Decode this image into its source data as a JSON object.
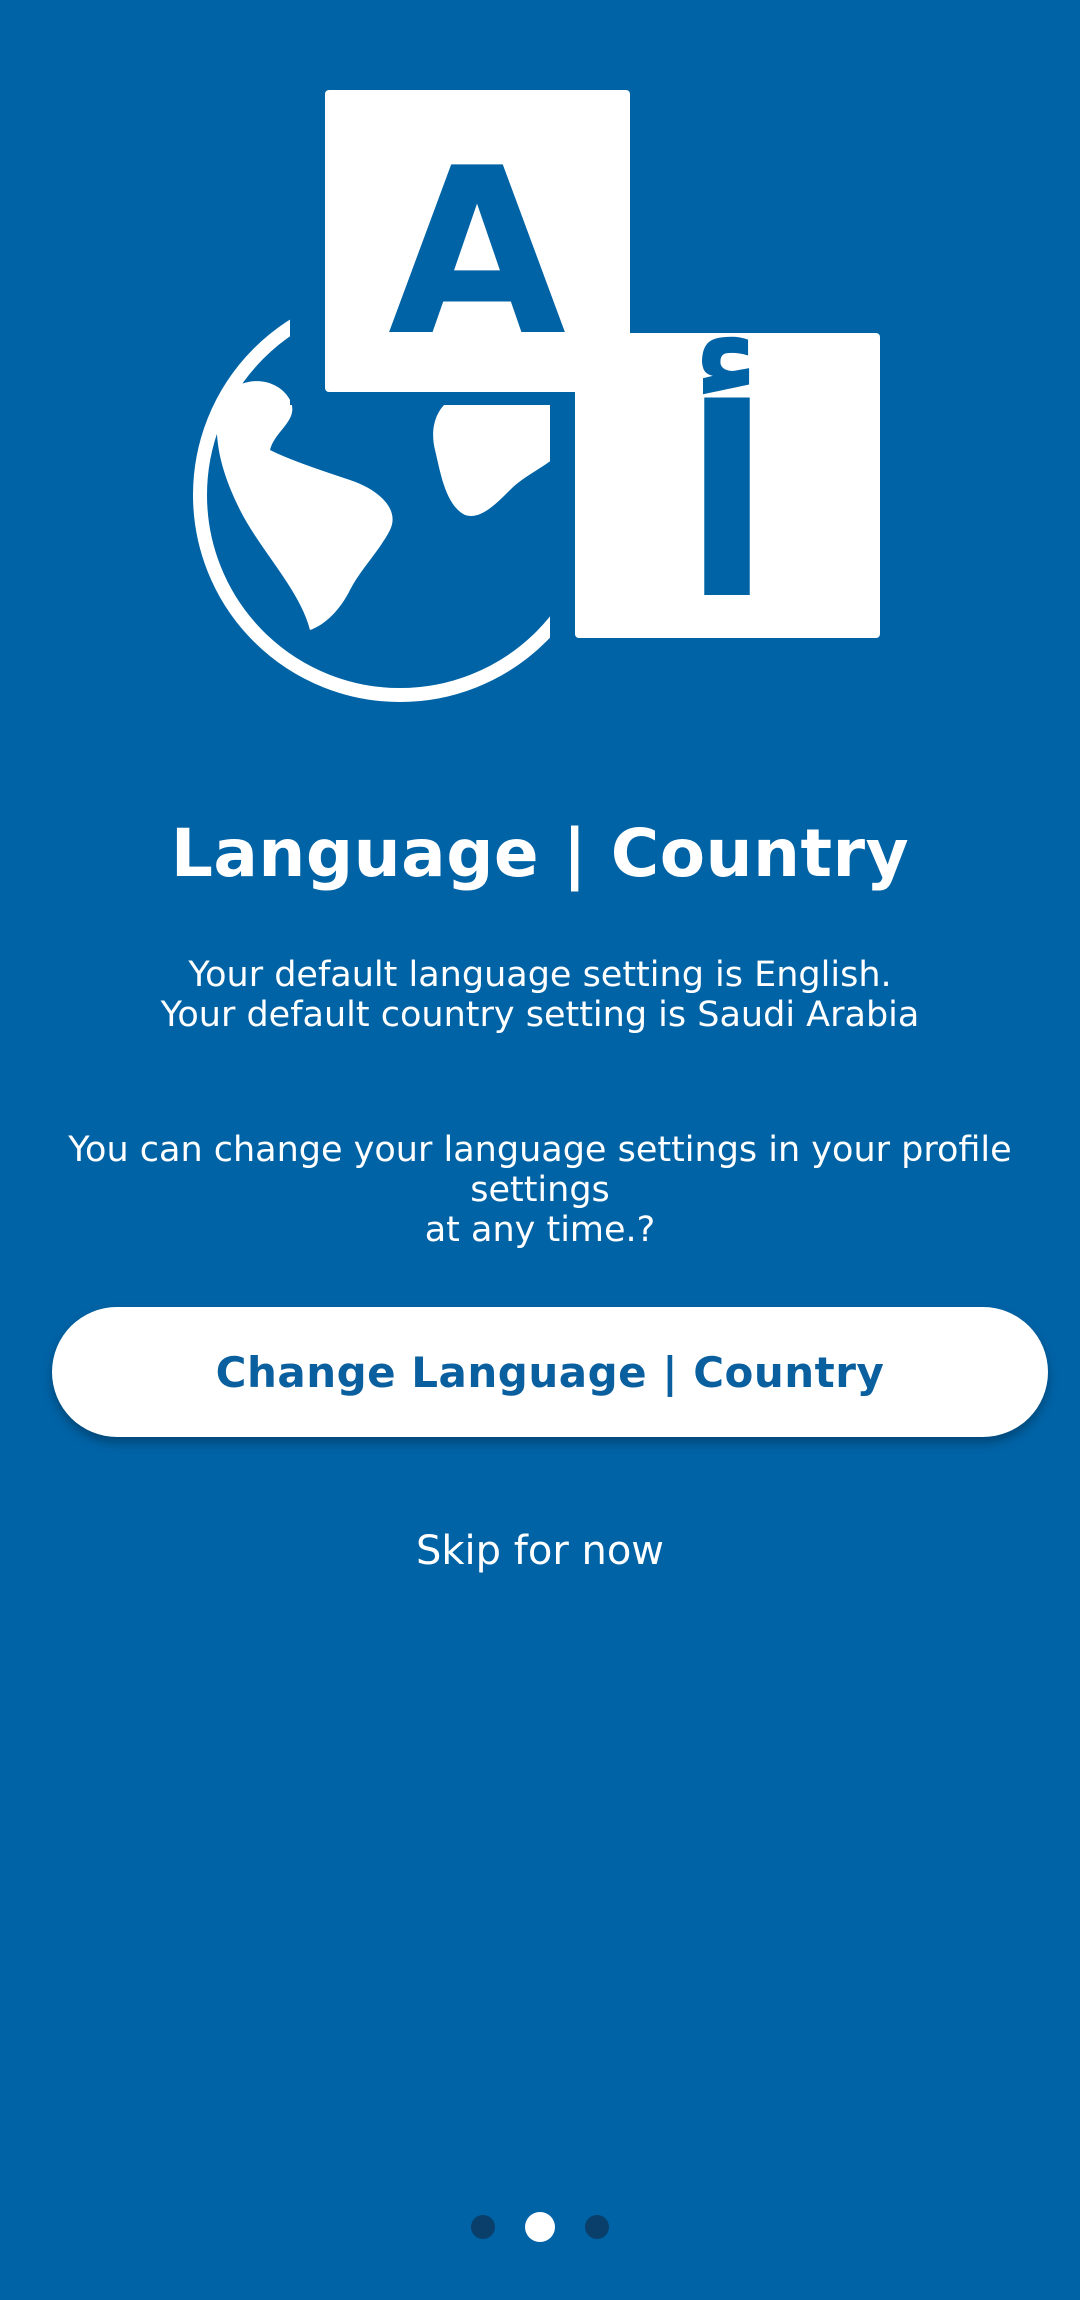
{
  "colors": {
    "background": "#0063a6",
    "primary_text": "#ffffff",
    "button_background": "#ffffff",
    "button_text": "#0a5f9e",
    "pager_inactive": "#0a3f6b",
    "pager_active": "#ffffff"
  },
  "illustration": {
    "icon": "globe-language-icon",
    "latin_letter": "A",
    "arabic_letter": "أ"
  },
  "onboarding": {
    "title": "Language | Country",
    "default_language_text": "Your default language setting is English.",
    "default_country_text": "Your default country setting is Saudi Arabia",
    "change_hint_line1": "You can change your language settings in your profile settings",
    "change_hint_line2": "at any time.?",
    "change_button_label": "Change Language | Country",
    "skip_label": "Skip for now"
  },
  "pager": {
    "total_pages": 3,
    "active_page": 2
  }
}
